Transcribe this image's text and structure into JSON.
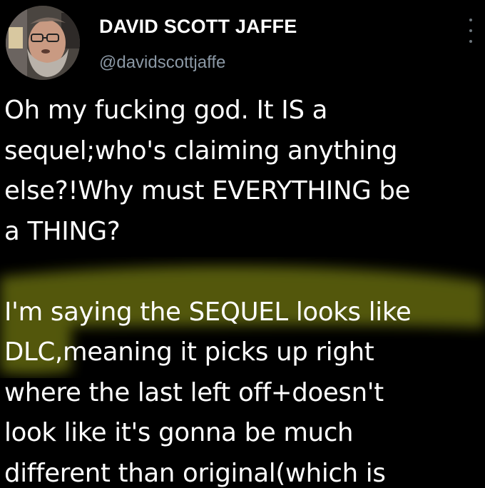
{
  "author": {
    "display_name": "DAVID SCOTT JAFFE",
    "handle": "@davidscottjaffe"
  },
  "tweet": {
    "lines": [
      "Oh my fucking god. It IS a",
      "sequel;who's claiming anything",
      "else?!Why must EVERYTHING be",
      "a THING?",
      "",
      "I'm saying the SEQUEL looks like",
      "DLC,meaning it picks up right",
      "where the last left off+doesn't",
      "look like it's gonna be much",
      "different than original(which is"
    ]
  },
  "icons": {
    "avatar": "avatar-photo",
    "more": "more-options-icon"
  },
  "colors": {
    "background": "#000000",
    "text": "#ffffff",
    "handle": "#8b98a5",
    "highlight": "#c8d21e"
  }
}
